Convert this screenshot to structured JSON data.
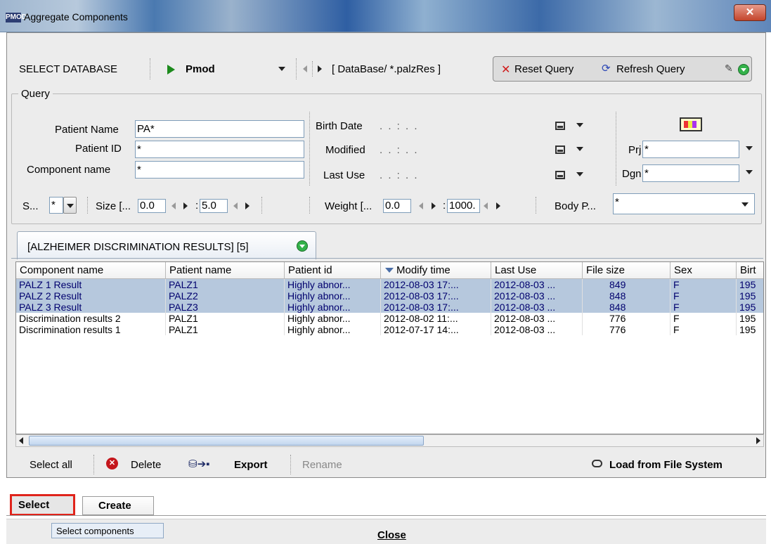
{
  "window": {
    "title": "Aggregate Components",
    "icon_text": "PMOD"
  },
  "database": {
    "label": "SELECT DATABASE",
    "selected": "Pmod",
    "path": "[ DataBase/ *.palzRes ]",
    "reset_label": "Reset Query",
    "refresh_label": "Refresh Query"
  },
  "query": {
    "legend": "Query",
    "patient_name_label": "Patient Name",
    "patient_name_value": "PA*",
    "patient_id_label": "Patient ID",
    "patient_id_value": "*",
    "component_name_label": "Component name",
    "component_name_value": "*",
    "birth_date_label": "Birth Date",
    "modified_label": "Modified",
    "last_use_label": "Last Use",
    "date_placeholder": ".      .      :      .      .",
    "prj_label": "Prj",
    "prj_value": "*",
    "dgn_label": "Dgn",
    "dgn_value": "*",
    "sex_label": "S...",
    "sex_value": "*",
    "size_label": "Size [...",
    "size_min": "0.0",
    "size_max": "5.0",
    "size_sep": ":",
    "weight_label": "Weight [...",
    "weight_min": "0.0",
    "weight_max": "1000.",
    "weight_sep": ":",
    "body_part_label": "Body P...",
    "body_part_value": "*"
  },
  "results_tab": {
    "label": "[ALZHEIMER DISCRIMINATION RESULTS] [5]"
  },
  "table": {
    "columns": [
      "Component name",
      "Patient name",
      "Patient id",
      "Modify time",
      "Last Use",
      "File size",
      "Sex",
      "Birt"
    ],
    "sort_column": "Modify time",
    "rows": [
      {
        "selected": true,
        "cells": [
          "PALZ 1 Result",
          "PALZ1",
          "Highly abnor...",
          "2012-08-03 17:...",
          "2012-08-03 ...",
          "849",
          "F",
          "195"
        ]
      },
      {
        "selected": true,
        "cells": [
          "PALZ 2 Result",
          "PALZ2",
          "Highly abnor...",
          "2012-08-03 17:...",
          "2012-08-03 ...",
          "848",
          "F",
          "195"
        ]
      },
      {
        "selected": true,
        "cells": [
          "PALZ 3 Result",
          "PALZ3",
          "Highly abnor...",
          "2012-08-03 17:...",
          "2012-08-03 ...",
          "848",
          "F",
          "195"
        ]
      },
      {
        "selected": false,
        "cells": [
          "Discrimination  results  2",
          "PALZ1",
          "Highly abnor...",
          "2012-08-02 11:...",
          "2012-08-03 ...",
          "776",
          "F",
          "195"
        ]
      },
      {
        "selected": false,
        "cells": [
          "Discrimination  results  1",
          "PALZ1",
          "Highly abnor...",
          "2012-07-17 14:...",
          "2012-08-03 ...",
          "776",
          "F",
          "195"
        ]
      }
    ]
  },
  "actions": {
    "select_all": "Select all",
    "delete": "Delete",
    "export": "Export",
    "rename": "Rename",
    "load_fs": "Load from File System"
  },
  "bottom_tabs": {
    "select": "Select",
    "create": "Create"
  },
  "footer": {
    "tooltip": "Select components",
    "close": "Close"
  },
  "colors": {
    "selected_row": "#b6c8dd",
    "highlight_box": "#e0241b",
    "green_accent": "#33b24a"
  }
}
